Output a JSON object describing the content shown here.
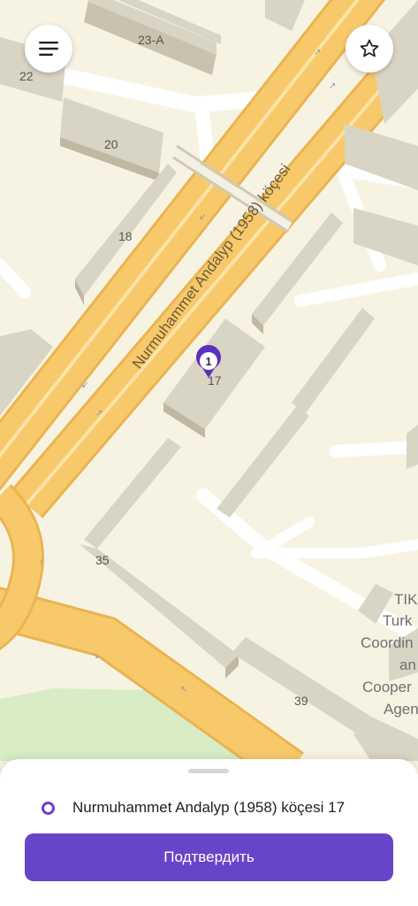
{
  "map": {
    "street_name": "Nurmuhammet Andalyp (1958) köçesi",
    "building_numbers": [
      "23-A",
      "22",
      "20",
      "18",
      "17",
      "35",
      "39"
    ],
    "poi_lines": [
      "TIK",
      "Turk",
      "Coordin",
      "an",
      "Cooper",
      "Agen"
    ],
    "marker_number": "1",
    "colors": {
      "road": "#f7c96b",
      "road_edge": "#e9b451",
      "building": "#d9d5c4",
      "background": "#f7f3e3",
      "park": "#d8edc6",
      "accent": "#6845c8"
    }
  },
  "controls": {
    "menu_icon": "hamburger-menu-icon",
    "favorite_icon": "star-outline-icon"
  },
  "sheet": {
    "address": "Nurmuhammet Andalyp (1958) köçesi 17",
    "confirm_label": "Подтвердить"
  }
}
